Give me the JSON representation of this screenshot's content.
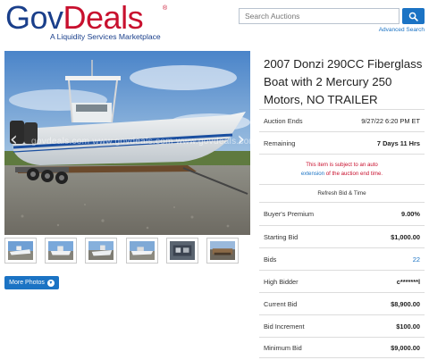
{
  "brand": {
    "logo_gov": "Gov",
    "logo_deals": "Deals",
    "logo_mark": "®",
    "tagline": "A Liquidity Services Marketplace"
  },
  "search": {
    "placeholder": "Search Auctions",
    "advanced_label": "Advanced Search"
  },
  "gallery": {
    "watermark": "govdeals.com  www.govdeals.com  www.govdeals.com",
    "thumbnail_count": 6,
    "more_photos_label": "More Photos"
  },
  "listing": {
    "title": "2007 Donzi 290CC Fiberglass Boat with 2 Mercury 250 Motors, NO TRAILER",
    "auction_ends_label": "Auction Ends",
    "auction_ends_value": "9/27/22 6:20 PM ET",
    "remaining_label": "Remaining",
    "remaining_value": "7 Days 11 Hrs",
    "notice_before": "This item is subject to an auto",
    "notice_link": "extension",
    "notice_after": "of the auction end time.",
    "refresh_label": "Refresh Bid & Time",
    "buyers_premium_label": "Buyer's Premium",
    "buyers_premium_value": "9.00%",
    "starting_bid_label": "Starting Bid",
    "starting_bid_value": "$1,000.00",
    "bids_label": "Bids",
    "bids_value": "22",
    "high_bidder_label": "High Bidder",
    "high_bidder_value": "c*******l",
    "current_bid_label": "Current Bid",
    "current_bid_value": "$8,900.00",
    "bid_increment_label": "Bid Increment",
    "bid_increment_value": "$100.00",
    "minimum_bid_label": "Minimum Bid",
    "minimum_bid_value": "$9,000.00"
  },
  "colors": {
    "brand_blue": "#1a3f8b",
    "brand_red": "#c8102e",
    "accent_blue": "#1b73c4"
  }
}
